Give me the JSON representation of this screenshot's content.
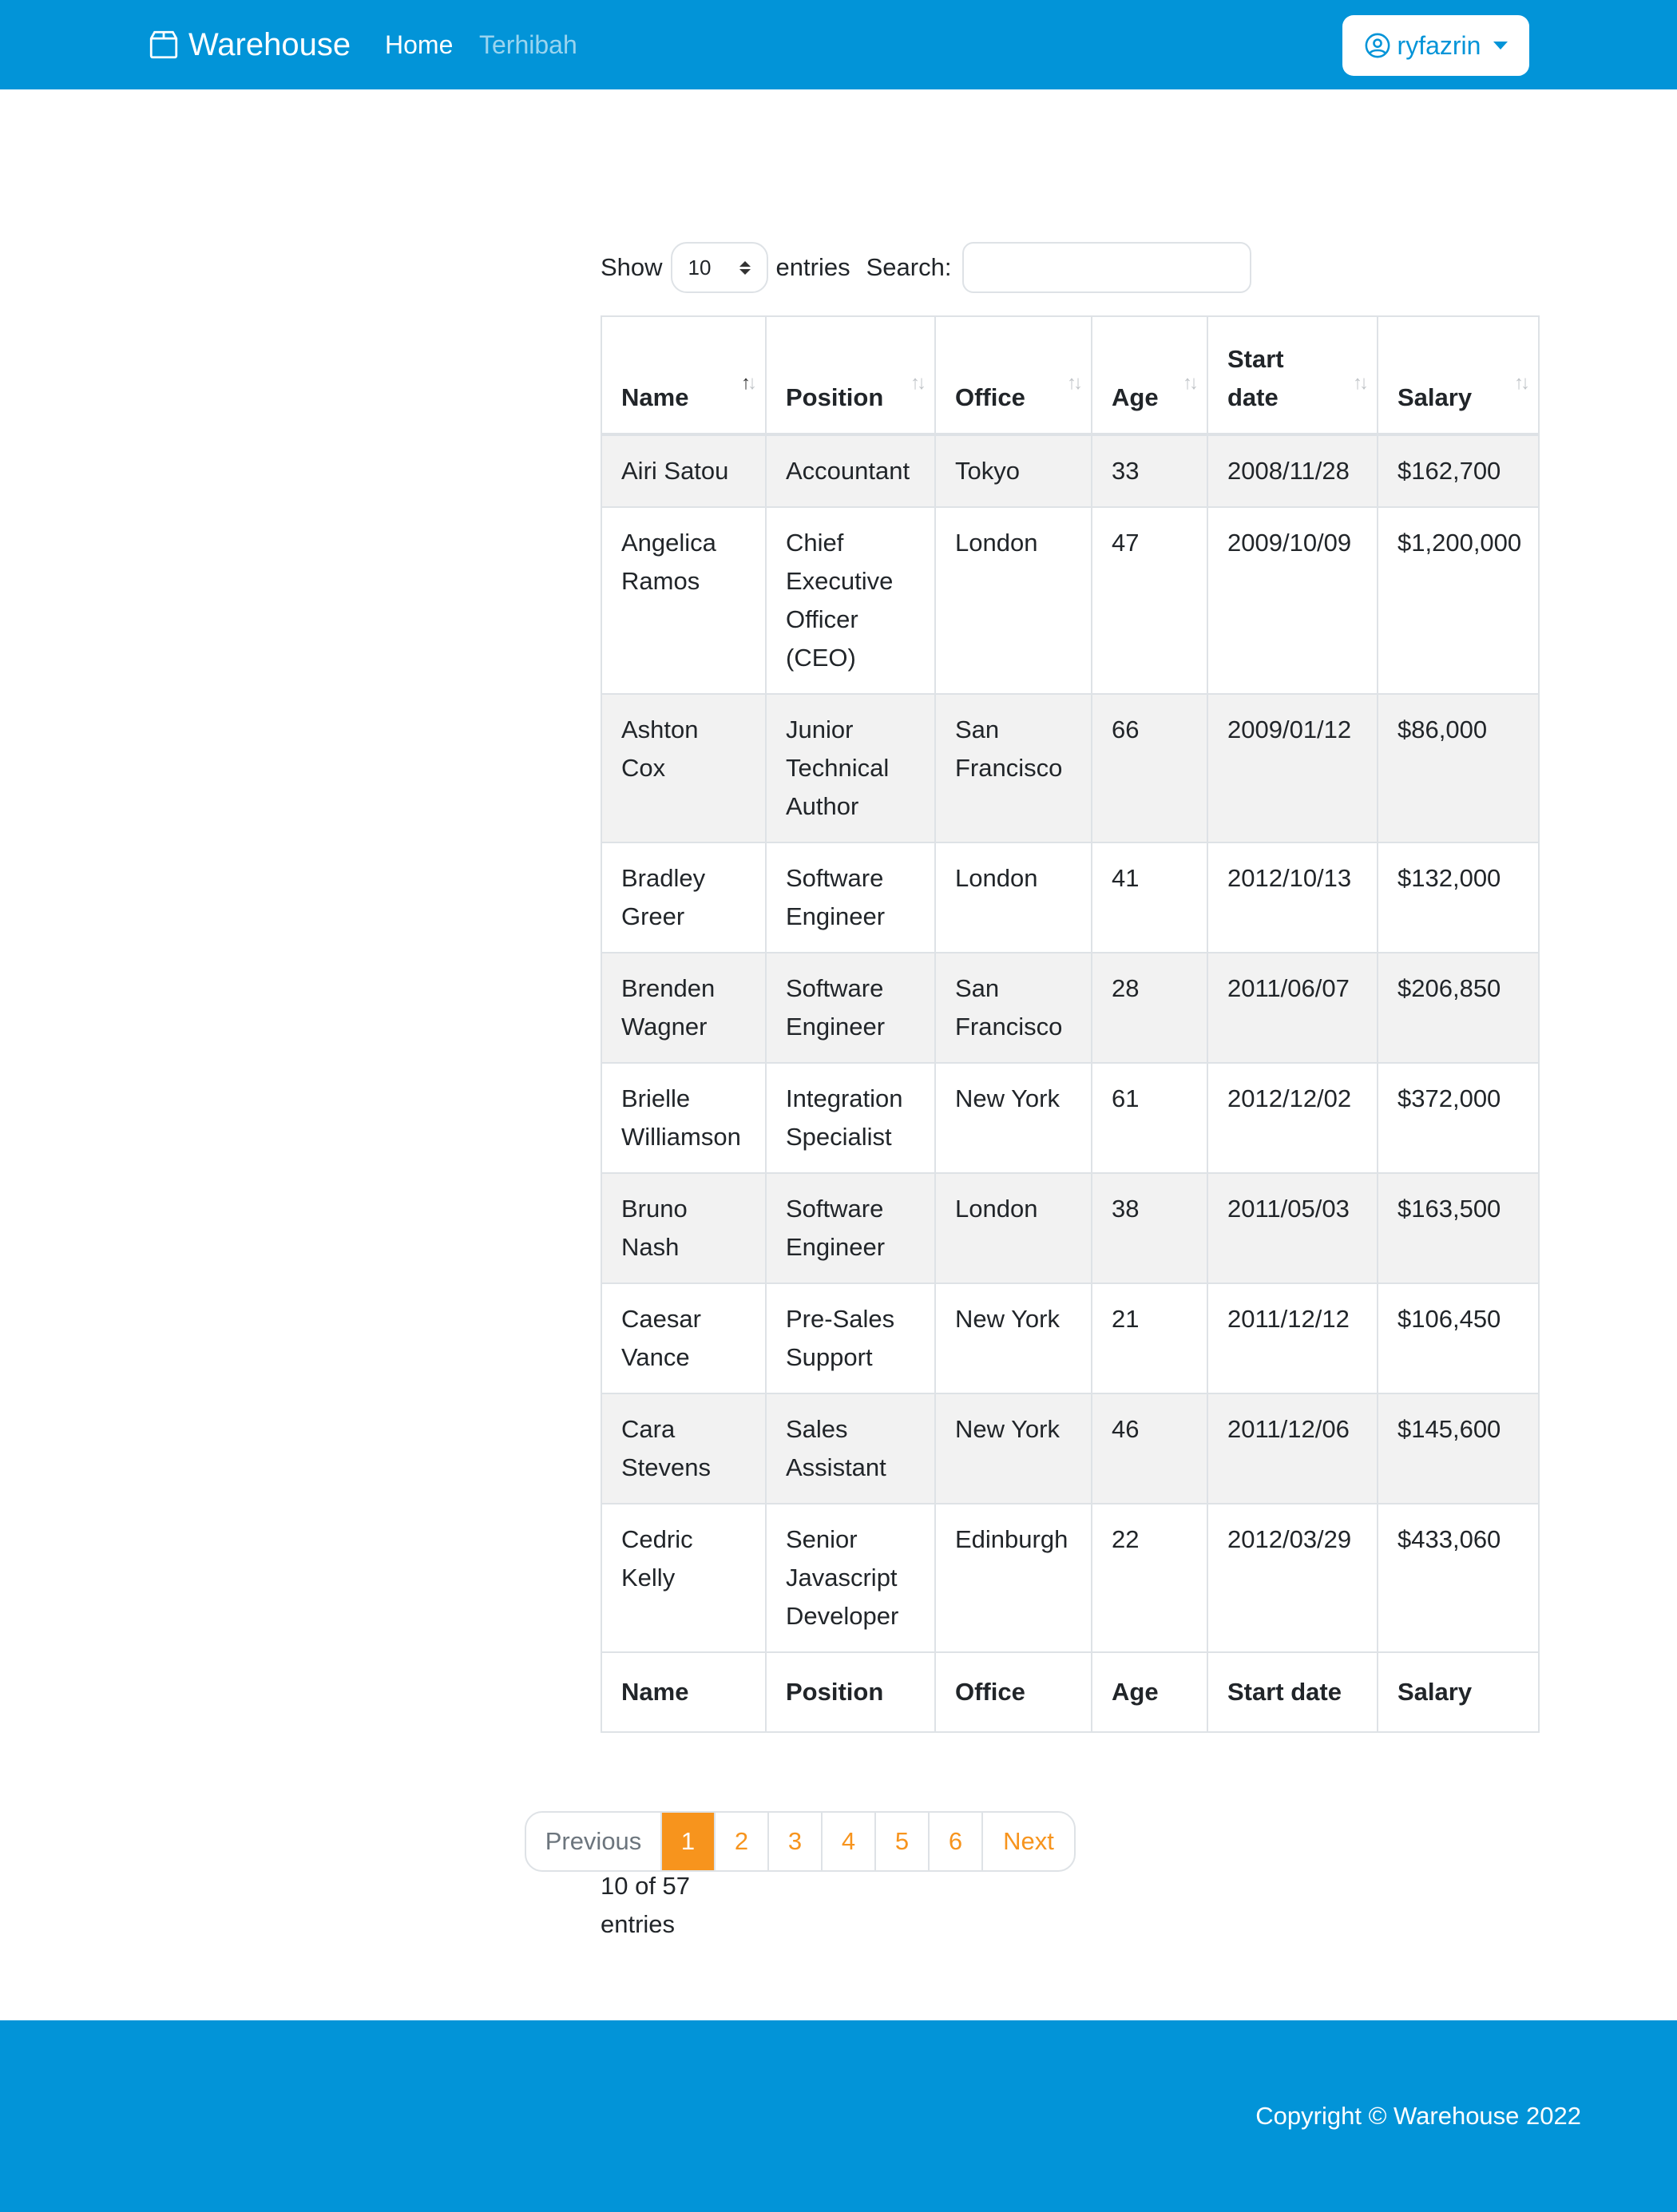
{
  "navbar": {
    "brand": "Warehouse",
    "links": [
      "Home",
      "Terhibah"
    ],
    "user": "ryfazrin"
  },
  "controls": {
    "show_label": "Show",
    "length_value": "10",
    "entries_label": "entries",
    "search_label": "Search:",
    "search_value": ""
  },
  "table": {
    "columns": [
      "Name",
      "Position",
      "Office",
      "Age",
      "Start date",
      "Salary"
    ],
    "header_display": [
      "Name",
      "Position",
      "Office",
      "Age",
      "Start\ndate",
      "Salary"
    ],
    "rows": [
      [
        "Airi Satou",
        "Accountant",
        "Tokyo",
        "33",
        "2008/11/28",
        "$162,700"
      ],
      [
        "Angelica Ramos",
        "Chief Executive Officer (CEO)",
        "London",
        "47",
        "2009/10/09",
        "$1,200,000"
      ],
      [
        "Ashton Cox",
        "Junior Technical Author",
        "San Francisco",
        "66",
        "2009/01/12",
        "$86,000"
      ],
      [
        "Bradley Greer",
        "Software Engineer",
        "London",
        "41",
        "2012/10/13",
        "$132,000"
      ],
      [
        "Brenden Wagner",
        "Software Engineer",
        "San Francisco",
        "28",
        "2011/06/07",
        "$206,850"
      ],
      [
        "Brielle Williamson",
        "Integration Specialist",
        "New York",
        "61",
        "2012/12/02",
        "$372,000"
      ],
      [
        "Bruno Nash",
        "Software Engineer",
        "London",
        "38",
        "2011/05/03",
        "$163,500"
      ],
      [
        "Caesar Vance",
        "Pre-Sales Support",
        "New York",
        "21",
        "2011/12/12",
        "$106,450"
      ],
      [
        "Cara Stevens",
        "Sales Assistant",
        "New York",
        "46",
        "2011/12/06",
        "$145,600"
      ],
      [
        "Cedric Kelly",
        "Senior Javascript Developer",
        "Edinburgh",
        "22",
        "2012/03/29",
        "$433,060"
      ]
    ],
    "sort_column": "Name",
    "sort_direction": "ascending"
  },
  "pagination": {
    "previous": "Previous",
    "pages": [
      "1",
      "2",
      "3",
      "4",
      "5",
      "6"
    ],
    "active": "1",
    "next": "Next",
    "info": "10 of 57 entries"
  },
  "footer": {
    "copyright": "Copyright © Warehouse 2022"
  },
  "colors": {
    "primary": "#0294d8",
    "accent": "#f7941d",
    "stripe": "#f2f2f2",
    "border": "#dee2e6"
  },
  "icons": {
    "brand": "box-icon",
    "user": "user-circle-icon",
    "dropdown": "caret-down-icon",
    "sort": "sort-arrows-icon"
  }
}
